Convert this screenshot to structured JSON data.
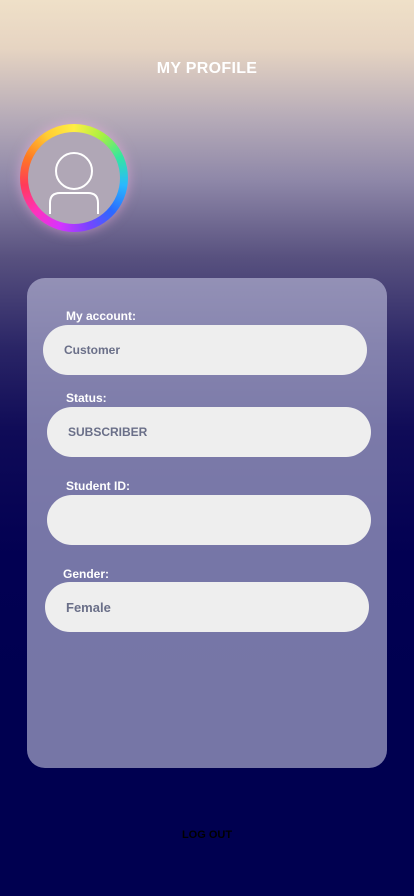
{
  "header": {
    "title": "MY PROFILE"
  },
  "avatar": {
    "icon": "user-icon"
  },
  "form": {
    "account": {
      "label": "My account:",
      "value": "Customer"
    },
    "status": {
      "label": "Status:",
      "value": "SUBSCRIBER"
    },
    "student_id": {
      "label": "Student ID:",
      "value": ""
    },
    "gender": {
      "label": "Gender:",
      "value": "Female"
    }
  },
  "footer": {
    "logout_label": "LOG OUT"
  },
  "colors": {
    "background_top": "#efe0c8",
    "background_bottom": "#000050",
    "field_bg": "#eeeeee",
    "field_text": "#6a6f88"
  }
}
